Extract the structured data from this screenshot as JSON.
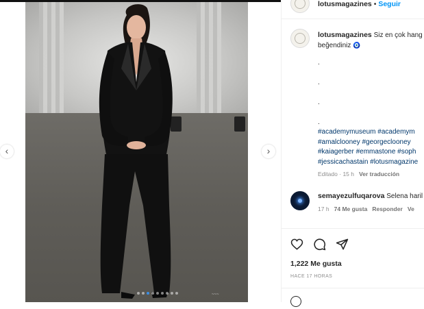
{
  "post": {
    "account": "lotusmagazines",
    "follow_separator": "•",
    "follow_label": "Seguir",
    "image_watermark": "~~~"
  },
  "caption": {
    "username": "lotusmagazines",
    "text_line1": "Siz en çok hang",
    "text_line2": "beğendiniz",
    "text_emoji": "🧿",
    "dot_lines": [
      ".",
      ".",
      ".",
      "."
    ],
    "hashtags": [
      "#academymuseum #academym",
      "#amalclooney #georgeclooney",
      "#kaiagerber #emmastone #soph",
      "#jessicachastain #lotusmagazine"
    ],
    "edited_label": "Editado",
    "separator": "·",
    "age": "15 h",
    "translate_label": "Ver traducción"
  },
  "comment": {
    "username": "semayezulfuqarova",
    "text": "Selena haril",
    "age": "17 h",
    "likes": "74 Me gusta",
    "reply_label": "Responder",
    "more_label": "Ve"
  },
  "actions": {
    "like_icon": "heart-icon",
    "comment_icon": "comment-icon",
    "share_icon": "share-icon"
  },
  "stats": {
    "likes": "1,222 Me gusta",
    "posted": "HACE 17 HORAS"
  },
  "carousel": {
    "prev_arrow": "‹",
    "next_arrow": "›",
    "slide_count": 9,
    "active_index": 2
  },
  "colors": {
    "link_blue": "#0095f6",
    "hashtag_blue": "#00376b",
    "active_dot": "#3a8ee6"
  }
}
